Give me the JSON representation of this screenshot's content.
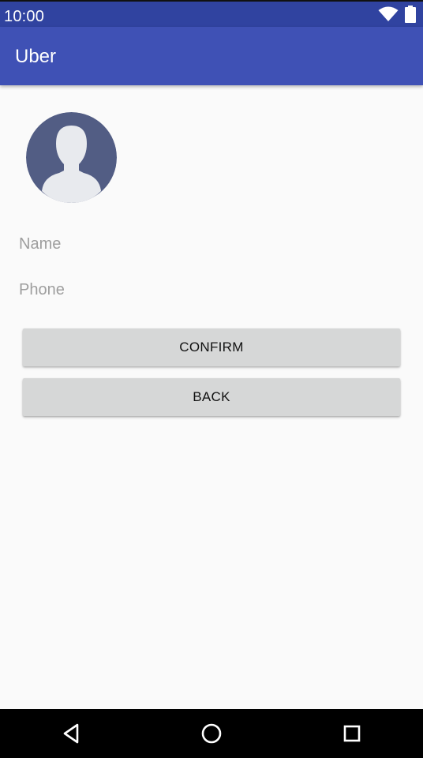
{
  "status_bar": {
    "time": "10:00",
    "icons": [
      "wifi-icon",
      "battery-icon"
    ]
  },
  "app_bar": {
    "title": "Uber",
    "color": "#3f51b5"
  },
  "profile": {
    "avatar_icon": "person-avatar-icon"
  },
  "form": {
    "name_placeholder": "Name",
    "name_value": "",
    "phone_placeholder": "Phone",
    "phone_value": ""
  },
  "buttons": {
    "confirm_label": "CONFIRM",
    "back_label": "BACK"
  },
  "nav_bar": {
    "icons": [
      "nav-back-icon",
      "nav-home-icon",
      "nav-recents-icon"
    ]
  }
}
